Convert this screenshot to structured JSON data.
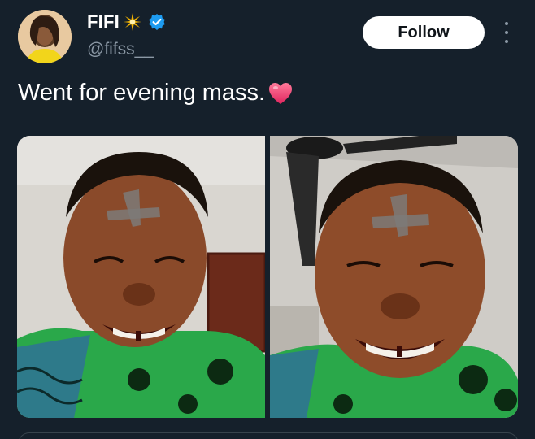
{
  "author": {
    "display_name": "FIFI",
    "handle": "@fifss__",
    "verified": true,
    "avatar_icon": "profile-avatar"
  },
  "actions": {
    "follow_label": "Follow",
    "more_icon": "more-vertical-icon"
  },
  "tweet": {
    "text": "Went for evening mass."
  },
  "media": {
    "photos": [
      {
        "description_icon": "photo-1"
      },
      {
        "description_icon": "photo-2"
      }
    ]
  },
  "colors": {
    "background": "#15202b",
    "text_primary": "#ffffff",
    "text_secondary": "#8b98a5",
    "verified_blue": "#1d9bf0",
    "follow_bg": "#ffffff",
    "heart": "#f0386b"
  }
}
